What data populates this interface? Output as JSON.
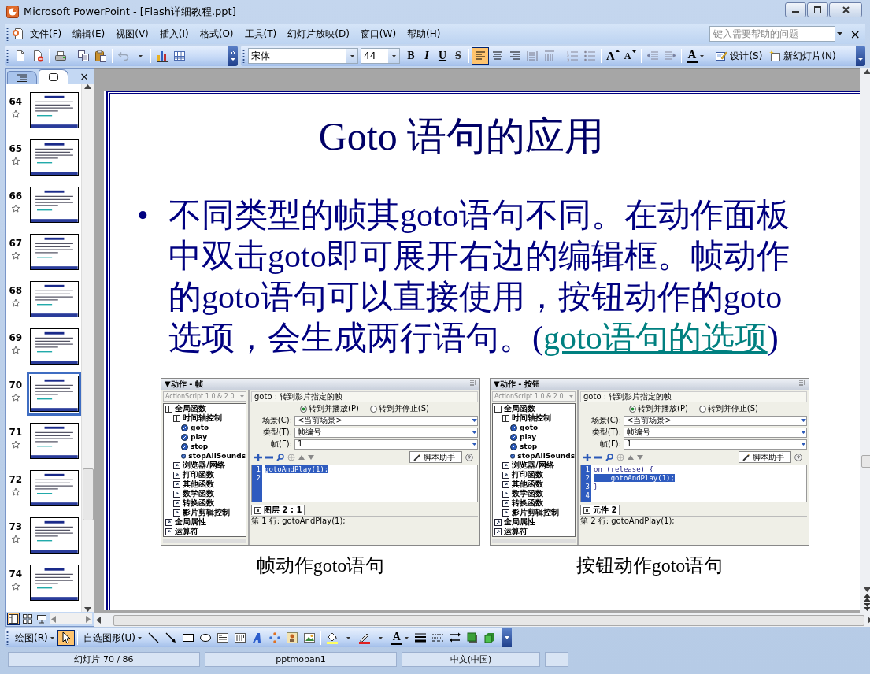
{
  "window": {
    "title": "Microsoft PowerPoint - [Flash详细教程.ppt]"
  },
  "menu": {
    "items": [
      "文件(F)",
      "编辑(E)",
      "视图(V)",
      "插入(I)",
      "格式(O)",
      "工具(T)",
      "幻灯片放映(D)",
      "窗口(W)",
      "帮助(H)"
    ],
    "help_field": {
      "placeholder": "键入需要帮助的问题"
    },
    "close_label": "×"
  },
  "formatting": {
    "font": "宋体",
    "size": "44",
    "style_buttons": [
      "B",
      "I",
      "U",
      "S"
    ],
    "align_buttons": [
      {
        "selected": true
      },
      {
        "selected": false
      },
      {
        "selected": false
      }
    ],
    "grow_font_label": "A",
    "shrink_font_label": "A",
    "font_color_label": "A",
    "design": "设计(S)",
    "new_slide": "新幻灯片(N)"
  },
  "sidebar": {
    "tabs": [
      {
        "selected": false
      },
      {
        "selected": true
      }
    ],
    "close_label": "×",
    "slides": [
      {
        "number": "64",
        "selected": false
      },
      {
        "number": "65",
        "selected": false
      },
      {
        "number": "66",
        "selected": false
      },
      {
        "number": "67",
        "selected": false
      },
      {
        "number": "68",
        "selected": false
      },
      {
        "number": "69",
        "selected": false
      },
      {
        "number": "70",
        "selected": true
      },
      {
        "number": "71",
        "selected": false
      },
      {
        "number": "72",
        "selected": false
      },
      {
        "number": "73",
        "selected": false
      },
      {
        "number": "74",
        "selected": false
      }
    ],
    "view_buttons": [
      {
        "selected": true
      },
      {
        "selected": false
      },
      {
        "selected": false
      }
    ]
  },
  "slide": {
    "title": "Goto 语句的应用",
    "bullet": "•",
    "text": "不同类型的帧其goto语句不同。在动作面板中双击goto即可展开右边的编辑框。帧动作的goto语句可以直接使用，按钮动作的goto选项，会生成两行语句。(",
    "link": "goto语句的选项",
    "text_after": ")",
    "panels": [
      {
        "header": "▼动作 - 帧",
        "language": "ActionScript 1.0 & 2.0",
        "tree": [
          {
            "label": "全局函数",
            "kind": "book",
            "children": [
              {
                "label": "时间轴控制",
                "kind": "book",
                "children": [
                  {
                    "label": "goto",
                    "kind": "action"
                  },
                  {
                    "label": "play",
                    "kind": "action"
                  },
                  {
                    "label": "stop",
                    "kind": "action"
                  },
                  {
                    "label": "stopAllSounds",
                    "kind": "action"
                  }
                ]
              },
              {
                "label": "浏览器/网络",
                "kind": "category"
              },
              {
                "label": "打印函数",
                "kind": "category"
              },
              {
                "label": "其他函数",
                "kind": "category"
              },
              {
                "label": "数学函数",
                "kind": "category"
              },
              {
                "label": "转换函数",
                "kind": "category"
              },
              {
                "label": "影片剪辑控制",
                "kind": "category"
              }
            ]
          },
          {
            "label": "全局属性",
            "kind": "category"
          },
          {
            "label": "运算符",
            "kind": "category"
          }
        ],
        "title": "goto : 转到影片指定的帧",
        "radios": [
          {
            "label": "转到并播放(P)",
            "selected": true
          },
          {
            "label": "转到并停止(S)",
            "selected": false
          }
        ],
        "fields": [
          {
            "label": "场景(C):",
            "value": "<当前场景>"
          },
          {
            "label": "类型(T):",
            "value": "帧编号"
          },
          {
            "label": "帧(F):",
            "value": "1"
          }
        ],
        "helper_button": "脚本助手",
        "code_lines": [
          {
            "number": "1",
            "text": "gotoAndPlay(1);",
            "selected": true
          },
          {
            "number": "2"
          }
        ],
        "tab": "图层 2 : 1",
        "status": "第 1 行: gotoAndPlay(1);",
        "caption": "帧动作goto语句"
      },
      {
        "header": "▼动作 - 按钮",
        "language": "ActionScript 1.0 & 2.0",
        "tree": [
          {
            "label": "全局函数",
            "kind": "book",
            "children": [
              {
                "label": "时间轴控制",
                "kind": "book",
                "children": [
                  {
                    "label": "goto",
                    "kind": "action"
                  },
                  {
                    "label": "play",
                    "kind": "action"
                  },
                  {
                    "label": "stop",
                    "kind": "action"
                  },
                  {
                    "label": "stopAllSounds",
                    "kind": "action"
                  }
                ]
              },
              {
                "label": "浏览器/网络",
                "kind": "category"
              },
              {
                "label": "打印函数",
                "kind": "category"
              },
              {
                "label": "其他函数",
                "kind": "category"
              },
              {
                "label": "数学函数",
                "kind": "category"
              },
              {
                "label": "转换函数",
                "kind": "category"
              },
              {
                "label": "影片剪辑控制",
                "kind": "category"
              }
            ]
          },
          {
            "label": "全局属性",
            "kind": "category"
          },
          {
            "label": "运算符",
            "kind": "category"
          }
        ],
        "title": "goto : 转到影片指定的帧",
        "radios": [
          {
            "label": "转到并播放(P)",
            "selected": true
          },
          {
            "label": "转到并停止(S)",
            "selected": false
          }
        ],
        "fields": [
          {
            "label": "场景(C):",
            "value": "<当前场景>"
          },
          {
            "label": "类型(T):",
            "value": "帧编号"
          },
          {
            "label": "帧(F):",
            "value": "1"
          }
        ],
        "helper_button": "脚本助手",
        "code_lines": [
          {
            "number": "1",
            "text": "on (release) {",
            "selected": false
          },
          {
            "number": "2",
            "text": "    gotoAndPlay(1);",
            "selected": true
          },
          {
            "number": "3",
            "text": "}",
            "selected": false
          },
          {
            "number": "4"
          }
        ],
        "tab": "元件 2",
        "status": "第 2 行: gotoAndPlay(1);",
        "caption": "按钮动作goto语句"
      }
    ]
  },
  "drawing_toolbar": {
    "menu": "绘图(R)",
    "select_tool": {
      "selected": true
    },
    "autoshapes": "自选图形(U)",
    "font_color_label": "A"
  },
  "status_bar": [
    "幻灯片 70 / 86",
    "pptmoban1",
    "中文(中国)"
  ]
}
